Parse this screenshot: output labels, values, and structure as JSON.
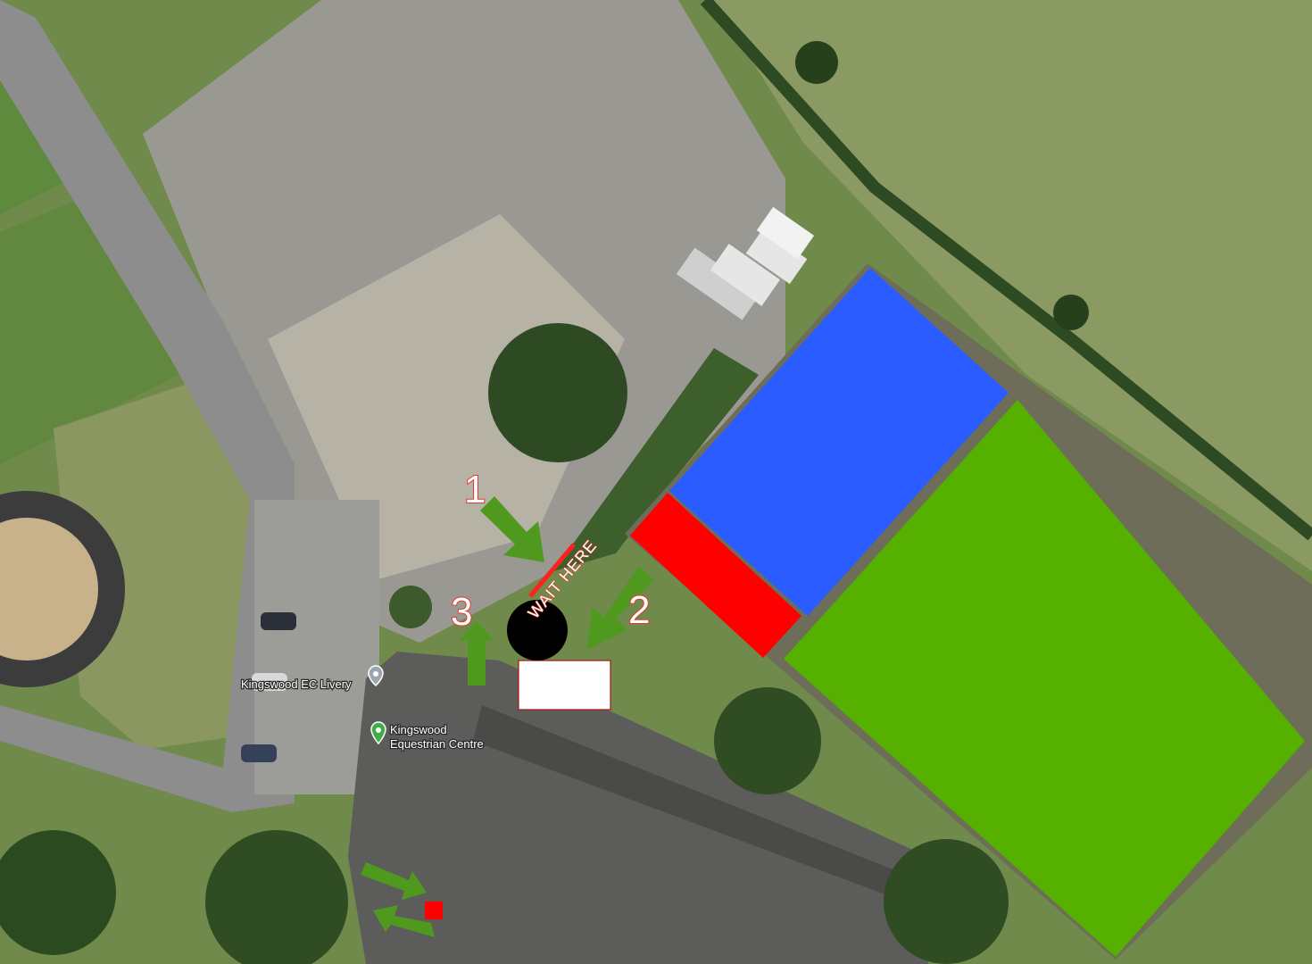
{
  "map": {
    "places": [
      {
        "label": "Kingswood EC Livery",
        "icon": "map-pin-grey-icon"
      },
      {
        "label_line1": "Kingswood",
        "label_line2": "Equestrian Centre",
        "icon": "map-pin-green-icon"
      }
    ],
    "steps": [
      "1",
      "2",
      "3"
    ],
    "annotation": "WAIT HERE",
    "zones": {
      "blue_area_color": "#2b5cff",
      "green_area_color": "#55b000",
      "red_area_color": "#ff0000",
      "white_box_color": "#ffffff",
      "arrow_color": "#4f9a1e"
    }
  }
}
